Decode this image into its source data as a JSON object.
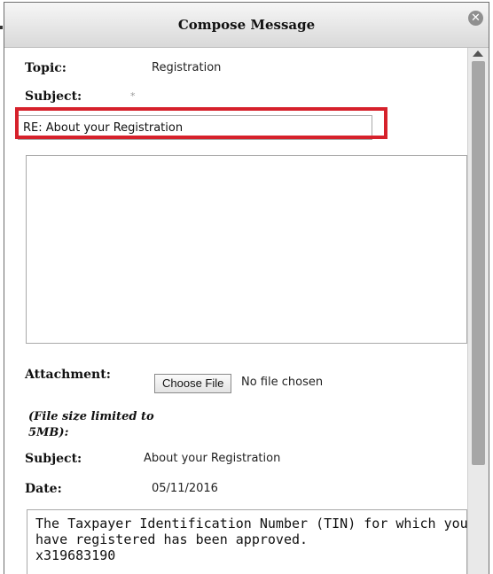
{
  "dialog": {
    "title": "Compose Message",
    "close_icon": "close-icon"
  },
  "form": {
    "topic_label": "Topic:",
    "topic_value": "Registration",
    "subject_label": "Subject:",
    "required_marker": "*",
    "subject_value": "RE: About your Registration",
    "body_value": "",
    "attachment_label": "Attachment:",
    "choose_file_label": "Choose File",
    "no_file_text": "No file chosen",
    "file_size_note": "(File size limited to 5MB):"
  },
  "original_message": {
    "subject_label": "Subject:",
    "subject_value": "About your Registration",
    "date_label": "Date:",
    "date_value": "05/11/2016",
    "body_lines": [
      "The Taxpayer Identification Number (TIN) for which you",
      "have registered has been approved.",
      "x319683190"
    ]
  },
  "colors": {
    "highlight": "#d6212b",
    "titlebar": "#e6e6e6"
  }
}
